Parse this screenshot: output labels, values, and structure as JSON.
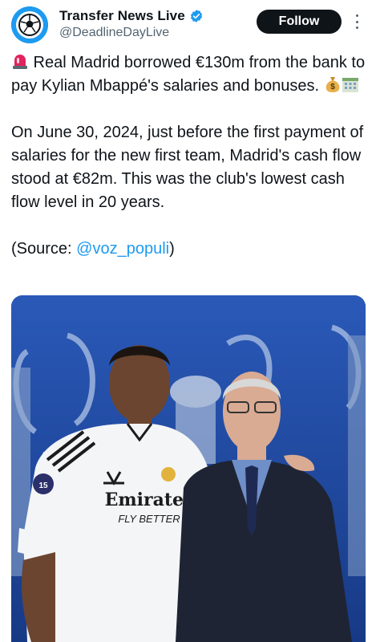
{
  "account": {
    "display_name": "Transfer News Live",
    "handle": "@DeadlineDayLive",
    "avatar_icon": "football-icon",
    "verified_icon": "verified-badge-icon",
    "verified_color": "#1d9bf0"
  },
  "actions": {
    "follow_label": "Follow",
    "more_icon": "more-options-icon"
  },
  "tweet": {
    "line1_emoji": "siren-icon",
    "line1_text": " Real Madrid borrowed €130m from the bank to pay Kylian Mbappé's salaries and bonuses. ",
    "line1_trailing_emojis": [
      "money-bag-icon",
      "bank-icon"
    ],
    "paragraph2": "On June 30, 2024, just before the first payment of salaries for the new first team, Madrid's cash flow stood at €82m. This was the club's lowest cash flow level in 20 years.",
    "source_prefix": "(Source: ",
    "source_link": "@voz_populi",
    "source_suffix": ")"
  },
  "media": {
    "jersey_sponsor_line1": "Emirates",
    "jersey_sponsor_line2": "FLY BETTER",
    "colors": {
      "background": "#1b3f8f",
      "link": "#1d9bf0",
      "follow_bg": "#0f1419"
    }
  }
}
